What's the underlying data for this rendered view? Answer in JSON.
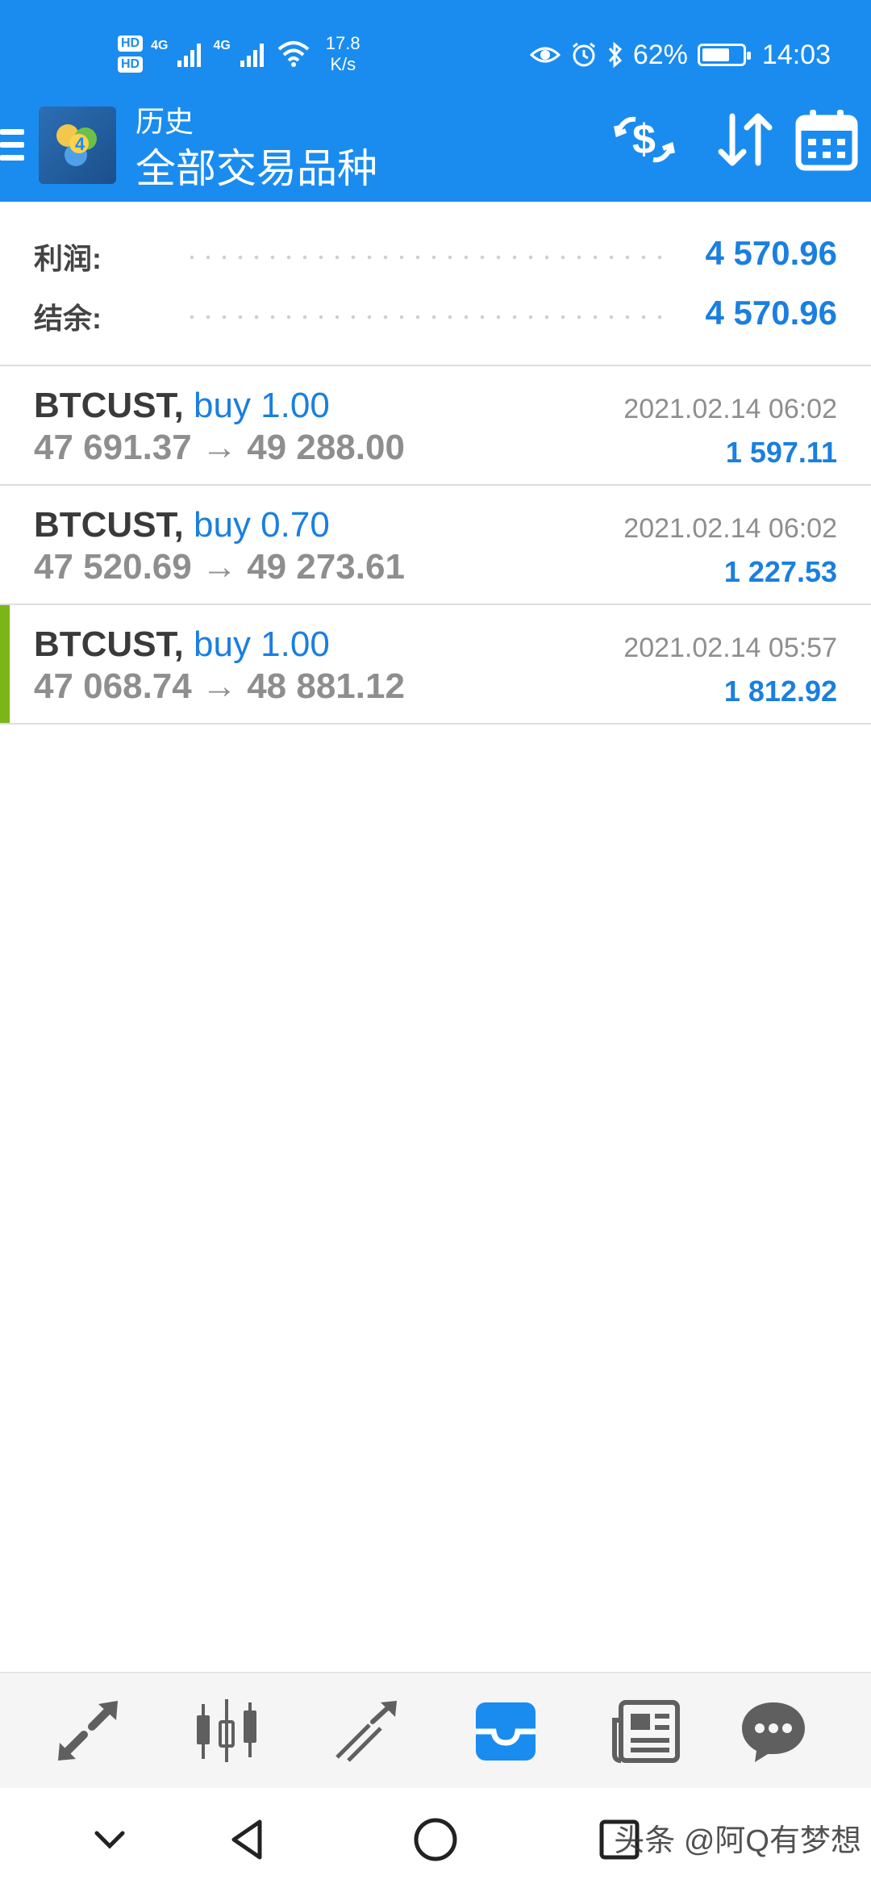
{
  "status_bar": {
    "hd1": "HD",
    "hd2": "HD",
    "net1": "4G",
    "net2": "4G",
    "speed_value": "17.8",
    "speed_unit": "K/s",
    "battery": "62%",
    "battery_level": 0.62,
    "time": "14:03"
  },
  "header": {
    "subtitle": "历史",
    "title": "全部交易品种"
  },
  "summary": {
    "profit_label": "利润:",
    "profit_value": "4 570.96",
    "balance_label": "结余:",
    "balance_value": "4 570.96"
  },
  "trades": [
    {
      "symbol": "BTCUST,",
      "side": "buy 1.00",
      "prices": "47 691.37 → 49 288.00",
      "datetime": "2021.02.14 06:02",
      "profit": "1 597.11"
    },
    {
      "symbol": "BTCUST,",
      "side": "buy 0.70",
      "prices": "47 520.69 → 49 273.61",
      "datetime": "2021.02.14 06:02",
      "profit": "1 227.53"
    },
    {
      "symbol": "BTCUST,",
      "side": "buy 1.00",
      "prices": "47 068.74 → 48 881.12",
      "datetime": "2021.02.14 05:57",
      "profit": "1 812.92"
    }
  ],
  "bottom_nav": {
    "items": [
      "quotes-icon",
      "chart-candles-icon",
      "trade-icon",
      "history-inbox-icon",
      "news-icon",
      "chat-icon"
    ],
    "active": "history-inbox-icon",
    "active_color": "#1a8cf0",
    "inactive_color": "#5f5f5f"
  },
  "watermark": "头条 @阿Q有梦想",
  "colors": {
    "header_bg": "#1a8cf0",
    "accent_blue": "#1a7fe0",
    "accent_green": "#7cb518"
  }
}
